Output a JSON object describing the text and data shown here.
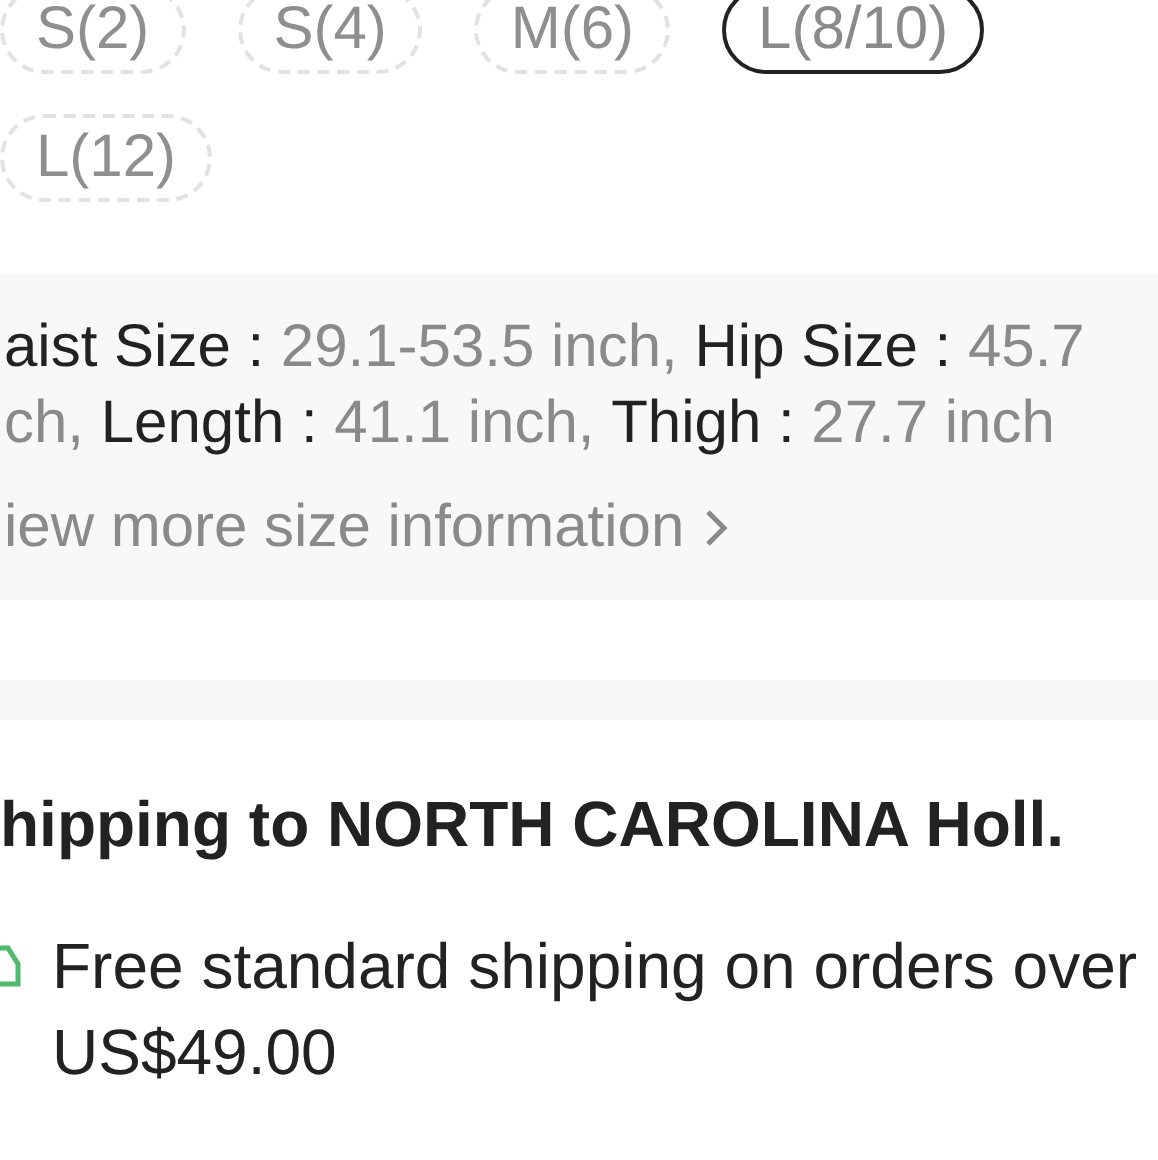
{
  "sizes": [
    {
      "label": "S(2)",
      "selected": false
    },
    {
      "label": "S(4)",
      "selected": false
    },
    {
      "label": "M(6)",
      "selected": false
    },
    {
      "label": "L(8/10)",
      "selected": true
    },
    {
      "label": "L(12)",
      "selected": false
    }
  ],
  "size_info": {
    "lines": [
      [
        {
          "kind": "label",
          "text": "aist Size :"
        },
        {
          "kind": "value",
          "text": "29.1-53.5 inch,"
        },
        {
          "kind": "label",
          "text": "Hip Size :"
        },
        {
          "kind": "value",
          "text": "45.7"
        }
      ],
      [
        {
          "kind": "value",
          "text": "ch,"
        },
        {
          "kind": "label",
          "text": "Length :"
        },
        {
          "kind": "value",
          "text": "41.1 inch,"
        },
        {
          "kind": "label",
          "text": "Thigh :"
        },
        {
          "kind": "value",
          "text": "27.7 inch"
        }
      ]
    ],
    "link": "iew more size information"
  },
  "shipping": {
    "title": "hipping to NORTH CAROLINA Holl.",
    "note": "Free standard shipping on orders over US$49.00"
  }
}
